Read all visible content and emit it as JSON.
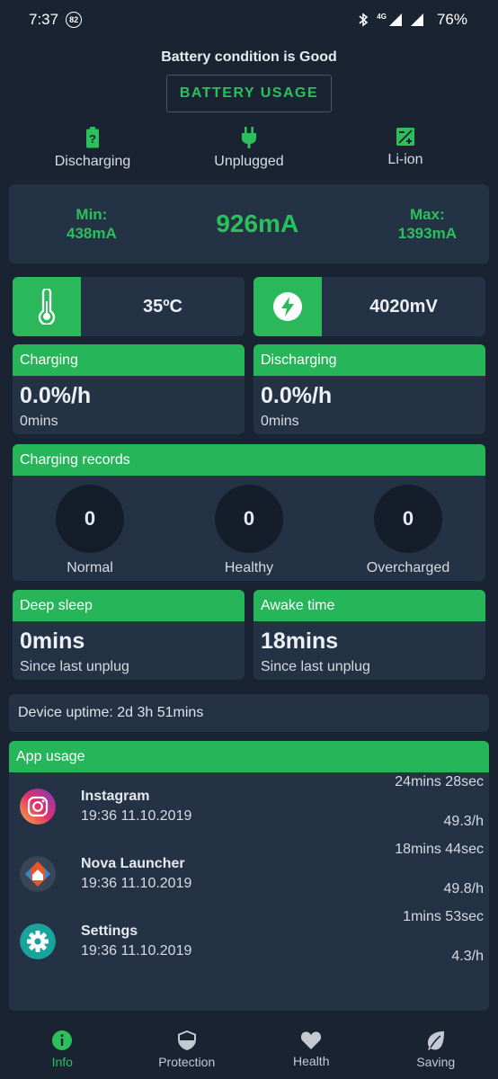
{
  "status_bar": {
    "time": "7:37",
    "notification_count": "82",
    "network": "4G",
    "battery": "76%"
  },
  "header": {
    "condition": "Battery condition is Good",
    "usage_button": "BATTERY USAGE"
  },
  "battery_status": [
    {
      "icon": "battery-unknown-icon",
      "label": "Discharging"
    },
    {
      "icon": "plug-icon",
      "label": "Unplugged"
    },
    {
      "icon": "battery-type-icon",
      "label": "Li-ion"
    }
  ],
  "current": {
    "min_label": "Min:",
    "min_value": "438mA",
    "value": "926mA",
    "max_label": "Max:",
    "max_value": "1393mA"
  },
  "temperature": {
    "icon": "thermometer-icon",
    "value": "35ºC"
  },
  "voltage": {
    "icon": "bolt-icon",
    "value": "4020mV"
  },
  "charging": {
    "title": "Charging",
    "rate": "0.0%/h",
    "time": "0mins"
  },
  "discharging": {
    "title": "Discharging",
    "rate": "0.0%/h",
    "time": "0mins"
  },
  "records": {
    "title": "Charging records",
    "items": [
      {
        "value": "0",
        "label": "Normal"
      },
      {
        "value": "0",
        "label": "Healthy"
      },
      {
        "value": "0",
        "label": "Overcharged"
      }
    ]
  },
  "deep_sleep": {
    "title": "Deep sleep",
    "value": "0mins",
    "sub": "Since last unplug"
  },
  "awake": {
    "title": "Awake time",
    "value": "18mins",
    "sub": "Since last unplug"
  },
  "uptime": "Device uptime: 2d 3h 51mins",
  "app_usage": {
    "title": "App usage",
    "apps": [
      {
        "name": "Instagram",
        "date": "19:36 11.10.2019",
        "time": "24mins 28sec",
        "rate": "49.3/h",
        "icon": "instagram-icon"
      },
      {
        "name": "Nova Launcher",
        "date": "19:36 11.10.2019",
        "time": "18mins 44sec",
        "rate": "49.8/h",
        "icon": "nova-launcher-icon"
      },
      {
        "name": "Settings",
        "date": "19:36 11.10.2019",
        "time": "1mins 53sec",
        "rate": "4.3/h",
        "icon": "settings-gear-icon"
      }
    ]
  },
  "nav": [
    {
      "label": "Info",
      "icon": "info-icon",
      "active": true
    },
    {
      "label": "Protection",
      "icon": "shield-icon",
      "active": false
    },
    {
      "label": "Health",
      "icon": "heart-icon",
      "active": false
    },
    {
      "label": "Saving",
      "icon": "leaf-icon",
      "active": false
    }
  ],
  "colors": {
    "accent": "#2cc05b",
    "background": "#1a2332",
    "card": "#243246"
  }
}
